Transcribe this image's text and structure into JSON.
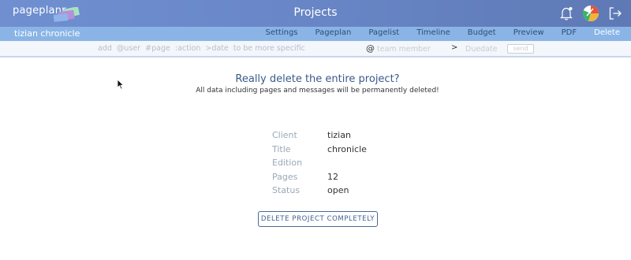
{
  "header": {
    "logo_text": "pageplanr",
    "title": "Projects"
  },
  "nav": {
    "project_name": "tizian chronicle",
    "tabs": [
      "Settings",
      "Pageplan",
      "Pagelist",
      "Timeline",
      "Budget",
      "Preview",
      "PDF",
      "Delete"
    ],
    "active_tab": "Delete"
  },
  "command": {
    "hint": "add  @user  #page  :action  >date  to be more specific",
    "at": "@",
    "member_placeholder": "team member",
    "gt": ">",
    "duedate_placeholder": "Duedate",
    "send_label": "send"
  },
  "confirm": {
    "title": "Really delete the entire project?",
    "subtitle": "All data including pages and messages will be permanently deleted!"
  },
  "details": {
    "client_label": "Client",
    "client_value": "tizian",
    "title_label": "Title",
    "title_value": "chronicle",
    "edition_label": "Edition",
    "edition_value": "",
    "pages_label": "Pages",
    "pages_value": "12",
    "status_label": "Status",
    "status_value": "open"
  },
  "delete_button": "DELETE PROJECT COMPLETELY",
  "colors": {
    "header_bg": "#6a88c9",
    "nav_bg": "#8ab4e6",
    "accent": "#3f5f8f"
  }
}
